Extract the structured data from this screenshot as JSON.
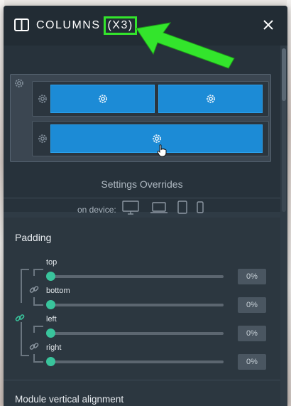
{
  "header": {
    "title": "COLUMNS",
    "count": "(X3)"
  },
  "icons": {
    "header": "columns-icon",
    "close": "close-icon",
    "gear": "gear-icon",
    "cursor": "hand-pointer-icon",
    "link": "link-icon",
    "arrow": "annotation-arrow"
  },
  "overrides": {
    "title": "Settings Overrides",
    "device_label": "on device:",
    "devices": [
      "desktop",
      "laptop",
      "tablet",
      "mobile"
    ]
  },
  "padding": {
    "title": "Padding",
    "sliders": [
      {
        "label": "top",
        "value": "0%",
        "level": 0
      },
      {
        "label": "bottom",
        "value": "0%",
        "level": 0
      },
      {
        "label": "left",
        "value": "0%",
        "level": 0
      },
      {
        "label": "right",
        "value": "0%",
        "level": 0
      }
    ]
  },
  "alignment": {
    "title": "Module vertical alignment"
  },
  "colors": {
    "panel": "#2f3b45",
    "header": "#222c34",
    "column": "#1c8bd6",
    "slider_knob": "#39c49c",
    "link_active": "#39c49c",
    "annotation": "#33e52c"
  }
}
